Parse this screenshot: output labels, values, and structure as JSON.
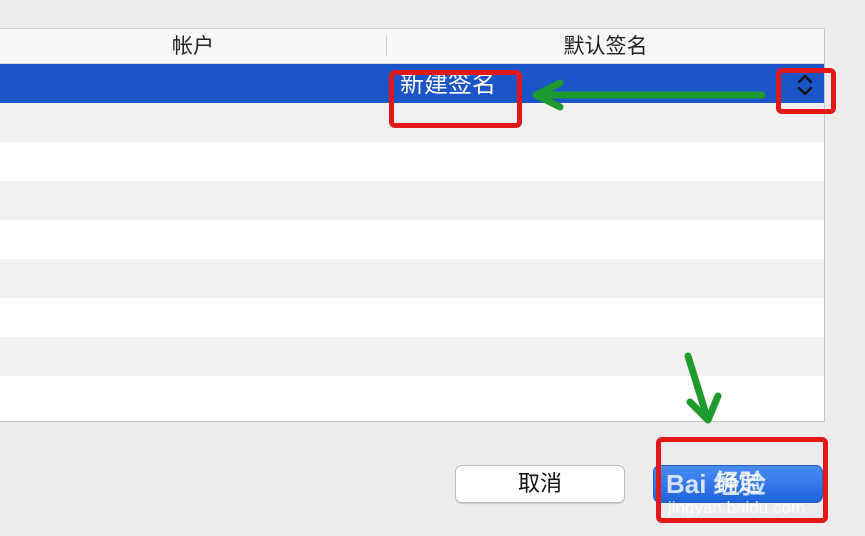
{
  "table": {
    "columns": [
      {
        "label": "帐户"
      },
      {
        "label": "默认签名"
      }
    ],
    "rows": [
      {
        "account": "",
        "signature": "新建签名",
        "selected": true
      }
    ]
  },
  "buttons": {
    "cancel_label": "取消",
    "ok_label": "确定"
  },
  "watermark": {
    "logo": "Bai 经验",
    "url": "jingyan.baidu.com"
  },
  "colors": {
    "selection": "#1b55c8",
    "annotation_box": "#e01818",
    "annotation_arrow": "#1f9a2f",
    "ok_button": "#1f63dc"
  },
  "icons": {
    "stepper": "up-down-chevron-icon",
    "arrow": "green-arrow-icon"
  }
}
